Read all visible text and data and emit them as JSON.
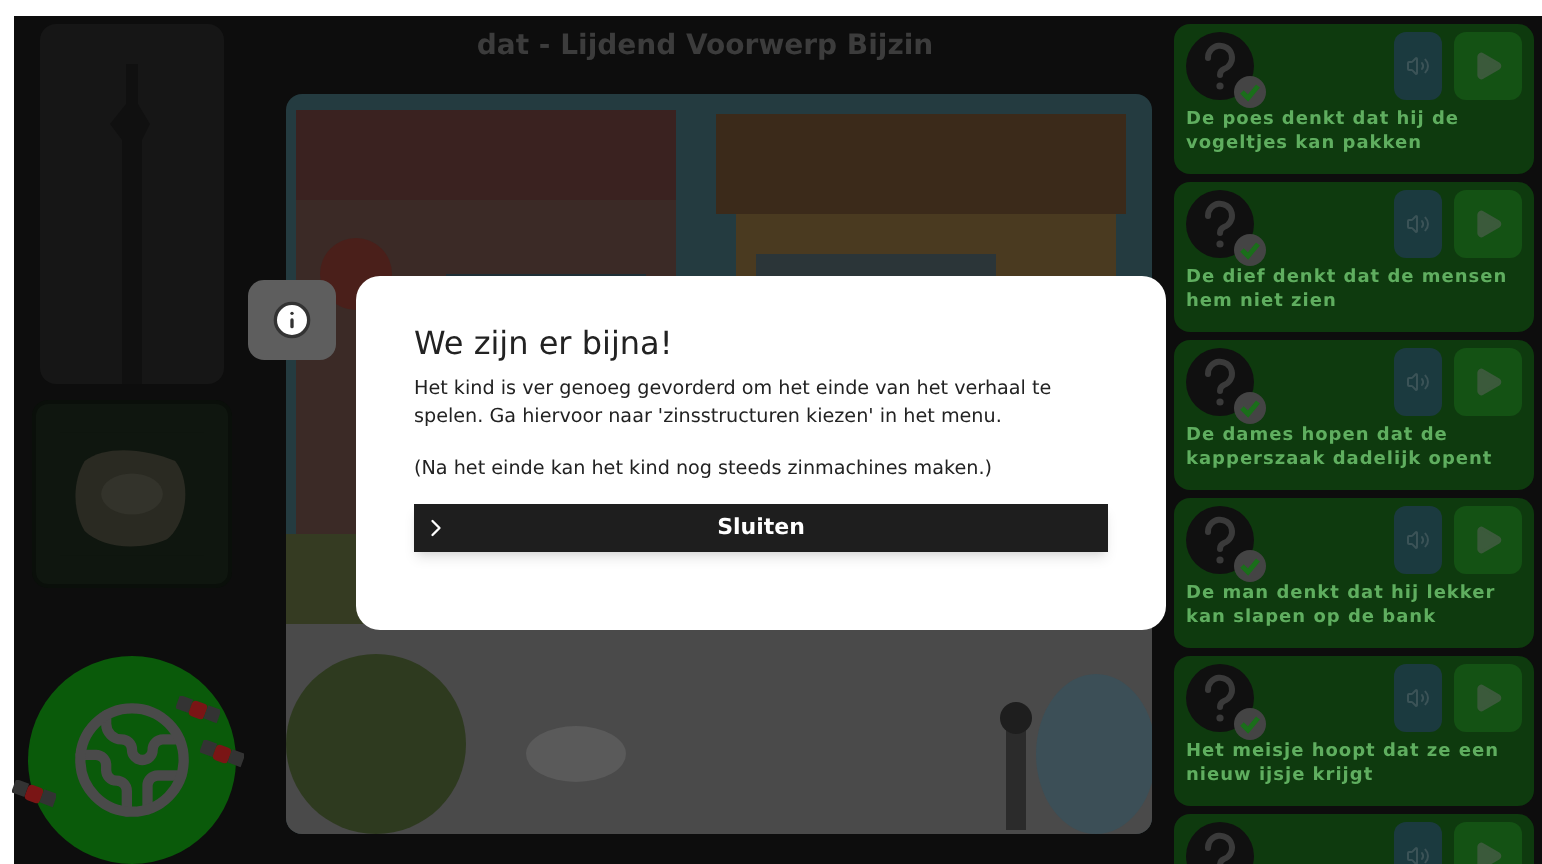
{
  "title": "dat - Lijdend Voorwerp Bijzin",
  "dialog": {
    "title": "We zijn er bijna!",
    "paragraphs": [
      "Het kind is ver genoeg gevorderd om het einde van het verhaal te spelen. Ga hiervoor naar 'zinsstructuren kiezen' in het menu.",
      "(Na het einde kan het kind nog steeds zinmachines maken.)"
    ],
    "button": "Sluiten"
  },
  "sentences": [
    {
      "kind": "full",
      "text": "De poes denkt dat hij de vogeltjes kan pakken"
    },
    {
      "kind": "full",
      "text": "De dief denkt dat de mensen hem niet zien"
    },
    {
      "kind": "full",
      "text": "De dames hopen dat de kapperszaak dadelijk opent"
    },
    {
      "kind": "full",
      "text": "De man denkt dat hij lekker kan slapen op de bank"
    },
    {
      "kind": "full",
      "text": "Het meisje hoopt dat ze een nieuw ijsje krijgt"
    },
    {
      "kind": "cut"
    }
  ]
}
